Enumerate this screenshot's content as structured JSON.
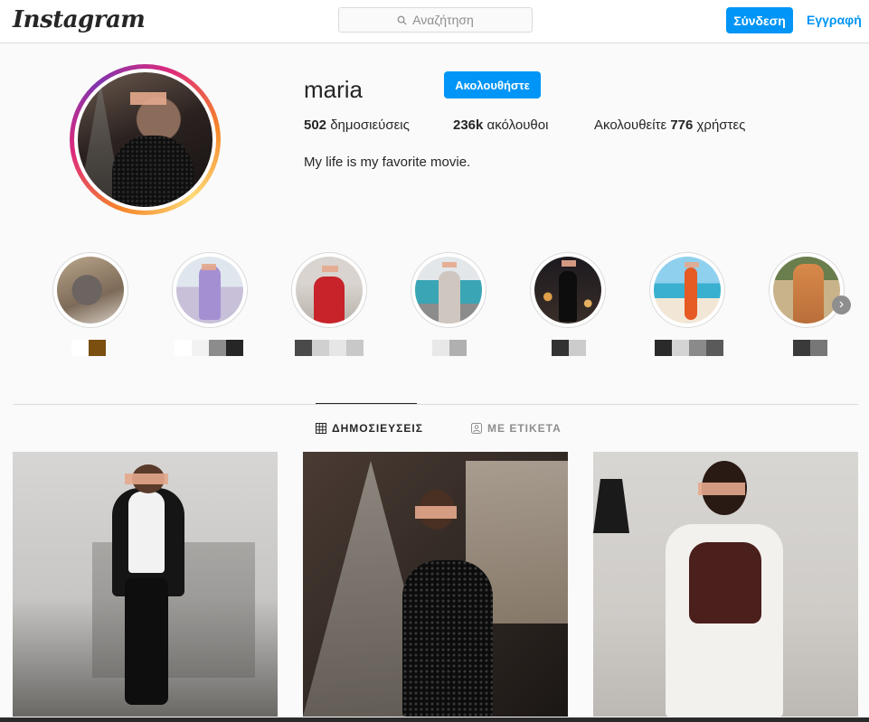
{
  "header": {
    "logo": "Instagram",
    "search_placeholder": "Αναζήτηση",
    "login_label": "Σύνδεση",
    "signup_label": "Εγγραφή"
  },
  "profile": {
    "username": "maria",
    "follow_label": "Ακολουθήστε",
    "posts_count": "502",
    "posts_label": "δημοσιεύσεις",
    "followers_count": "236k",
    "followers_label": "ακόλουθοι",
    "following_prefix": "Ακολουθείτε",
    "following_count": "776",
    "following_suffix": "χρήστες",
    "bio": "My life is my favorite movie."
  },
  "highlights": [
    {
      "name": "highlight-1",
      "colors": [
        "#ffffff",
        "#7a4f10"
      ]
    },
    {
      "name": "highlight-2",
      "colors": [
        "#ffffff",
        "#f2f2f2",
        "#8c8c8c",
        "#262626"
      ]
    },
    {
      "name": "highlight-3",
      "colors": [
        "#4a4a4a",
        "#d0d0d0",
        "#e6e6e6",
        "#c8c8c8"
      ]
    },
    {
      "name": "highlight-4",
      "colors": [
        "#e8e8e8",
        "#b0b0b0"
      ]
    },
    {
      "name": "highlight-5",
      "colors": [
        "#333333",
        "#cccccc"
      ]
    },
    {
      "name": "highlight-6",
      "colors": [
        "#2a2a2a",
        "#d4d4d4",
        "#8a8a8a",
        "#5a5a5a"
      ]
    },
    {
      "name": "highlight-7",
      "colors": [
        "#3a3a3a",
        "#777777"
      ]
    }
  ],
  "tabs": {
    "posts": "ΔΗΜΟΣΙΕΥΣΕΙΣ",
    "tagged": "ΜΕ ΕΤΙΚΕΤΑ"
  },
  "colors": {
    "accent": "#0095f6",
    "border": "#dbdbdb",
    "text": "#262626",
    "muted": "#8e8e8e"
  }
}
